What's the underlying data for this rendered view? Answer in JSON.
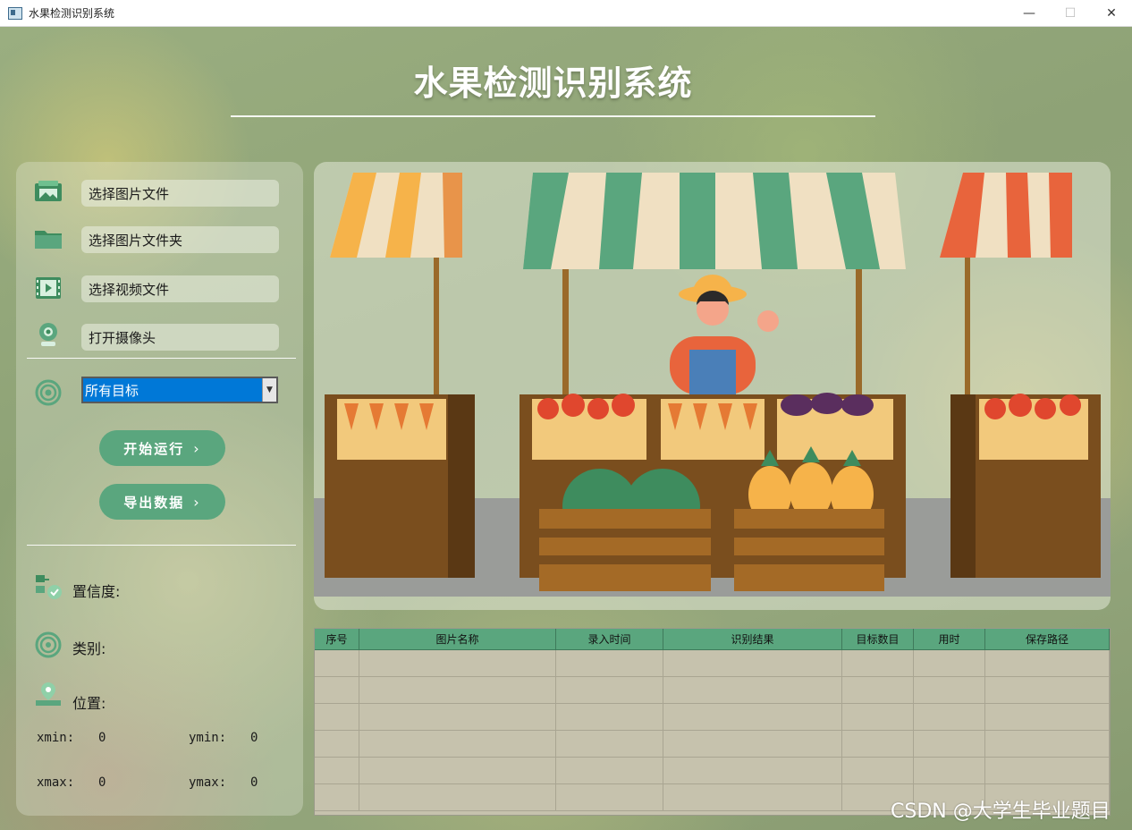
{
  "window": {
    "title": "水果检测识别系统",
    "minimize": "—",
    "maximize": "☐",
    "close": "✕"
  },
  "header": {
    "title": "水果检测识别系统"
  },
  "sidebar": {
    "items": [
      {
        "label": "选择图片文件",
        "icon": "image-file-icon"
      },
      {
        "label": "选择图片文件夹",
        "icon": "folder-icon"
      },
      {
        "label": "选择视频文件",
        "icon": "video-file-icon"
      },
      {
        "label": "打开摄像头",
        "icon": "camera-icon"
      }
    ],
    "target_select": {
      "value": "所有目标",
      "icon": "target-icon"
    },
    "start_button": "开始运行",
    "export_button": "导出数据",
    "chevron": "›"
  },
  "info": {
    "confidence_label": "置信度:",
    "class_label": "类别:",
    "position_label": "位置:",
    "xmin_label": "xmin:",
    "xmin_value": "0",
    "ymin_label": "ymin:",
    "ymin_value": "0",
    "xmax_label": "xmax:",
    "xmax_value": "0",
    "ymax_label": "ymax:",
    "ymax_value": "0"
  },
  "table": {
    "columns": [
      "序号",
      "图片名称",
      "录入时间",
      "识别结果",
      "目标数目",
      "用时",
      "保存路径"
    ],
    "rows": [
      [],
      [],
      [],
      [],
      [],
      []
    ]
  },
  "watermark": "CSDN @大学生毕业题目",
  "colors": {
    "accent": "#5aa67e",
    "select_bg": "#0078d7",
    "table_bg": "#c6c2ad"
  }
}
